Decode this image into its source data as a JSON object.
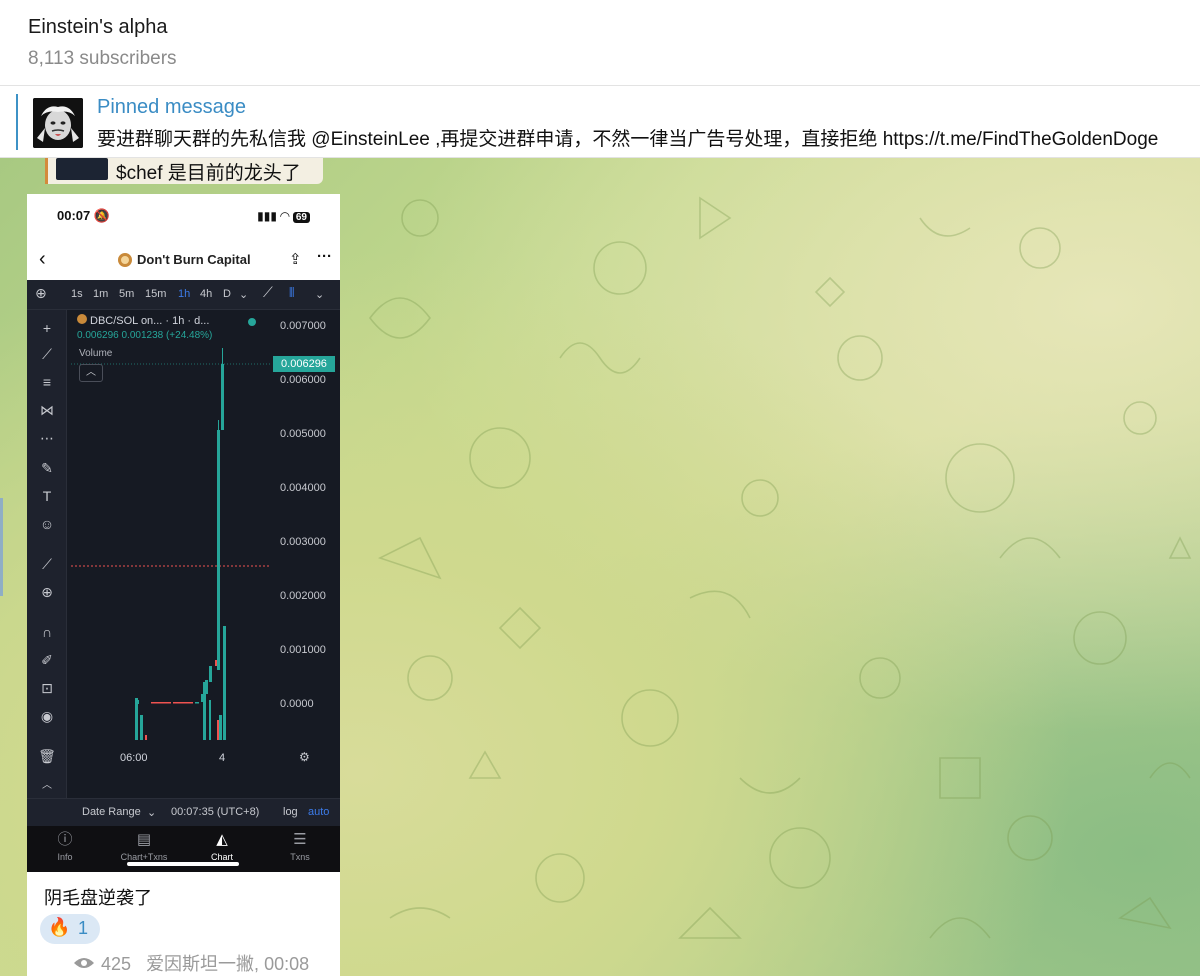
{
  "channel": {
    "title": "Einstein's alpha",
    "subscribers": "8,113 subscribers"
  },
  "pinned": {
    "label": "Pinned message",
    "text": "要进群聊天群的先私信我 @EinsteinLee ,再提交进群申请，不然一律当广告号处理，直接拒绝 https://t.me/FindTheGoldenDoge"
  },
  "quoted": {
    "text": "$chef 是目前的龙头了"
  },
  "phone": {
    "status_time": "00:07",
    "battery": "69",
    "nav_title": "Don't Burn Capital",
    "timeframes": [
      "1s",
      "1m",
      "5m",
      "15m",
      "1h",
      "4h",
      "D"
    ],
    "active_timeframe": "1h",
    "legend_pair": "DBC/SOL on... · 1h · d...",
    "legend_values": "0.006296  0.001238 (+24.48%)",
    "volume_label": "Volume",
    "current_price": "0.006296",
    "y_ticks": [
      "0.007000",
      "0.006000",
      "0.005000",
      "0.004000",
      "0.003000",
      "0.002000",
      "0.001000",
      "0.0000"
    ],
    "x_ticks": [
      "06:00",
      "4"
    ],
    "date_range": "Date Range",
    "time_readout": "00:07:35 (UTC+8)",
    "log_label": "log",
    "auto_label": "auto",
    "tabs": [
      "Info",
      "Chart+Txns",
      "Chart",
      "Txns"
    ],
    "active_tab": "Chart"
  },
  "caption": {
    "text": "阴毛盘逆袭了",
    "reaction_emoji": "🔥",
    "reaction_count": "1",
    "views": "425",
    "author_time": "爱因斯坦一撇, 00:08"
  },
  "colors": {
    "accent": "#3a8cc4",
    "candle_up": "#26a69a",
    "candle_down": "#ef5350",
    "chart_bg": "#161a23"
  }
}
